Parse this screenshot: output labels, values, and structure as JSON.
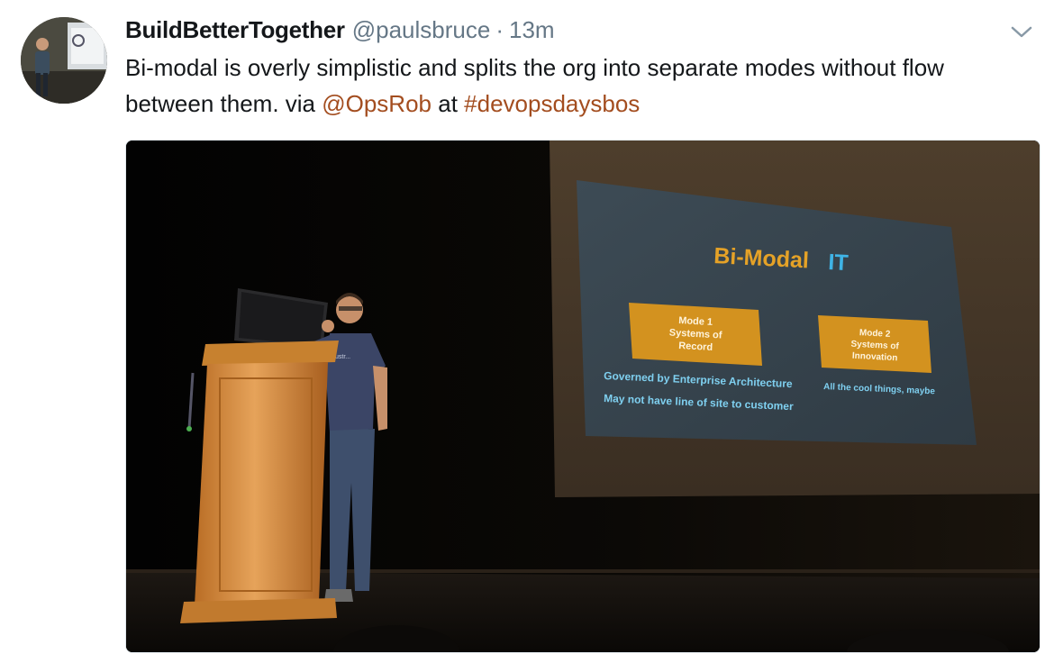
{
  "tweet": {
    "display_name": "BuildBetterTogether",
    "handle": "@paulsbruce",
    "separator": "·",
    "time": "13m",
    "text_prefix": "Bi-modal is overly simplistic and splits the org into separate modes without flow between them. via ",
    "mention": "@OpsRob",
    "text_middle": " at ",
    "hashtag": "#devopsdaysbos",
    "link_color": "#a34d1f"
  },
  "menu": {
    "icon": "chevron-down-icon"
  },
  "media": {
    "slide": {
      "title": "Bi-Modal",
      "title_accent": "IT",
      "mode1": {
        "line1": "Mode 1",
        "line2": "Systems of",
        "line3": "Record"
      },
      "mode2": {
        "line1": "Mode 2",
        "line2": "Systems of",
        "line3": "Innovation"
      },
      "caption1": "Governed by Enterprise Architecture",
      "caption2": "May not have line of site to customer",
      "caption3": "All the cool things, maybe"
    },
    "shirt_text": "ustr..."
  }
}
